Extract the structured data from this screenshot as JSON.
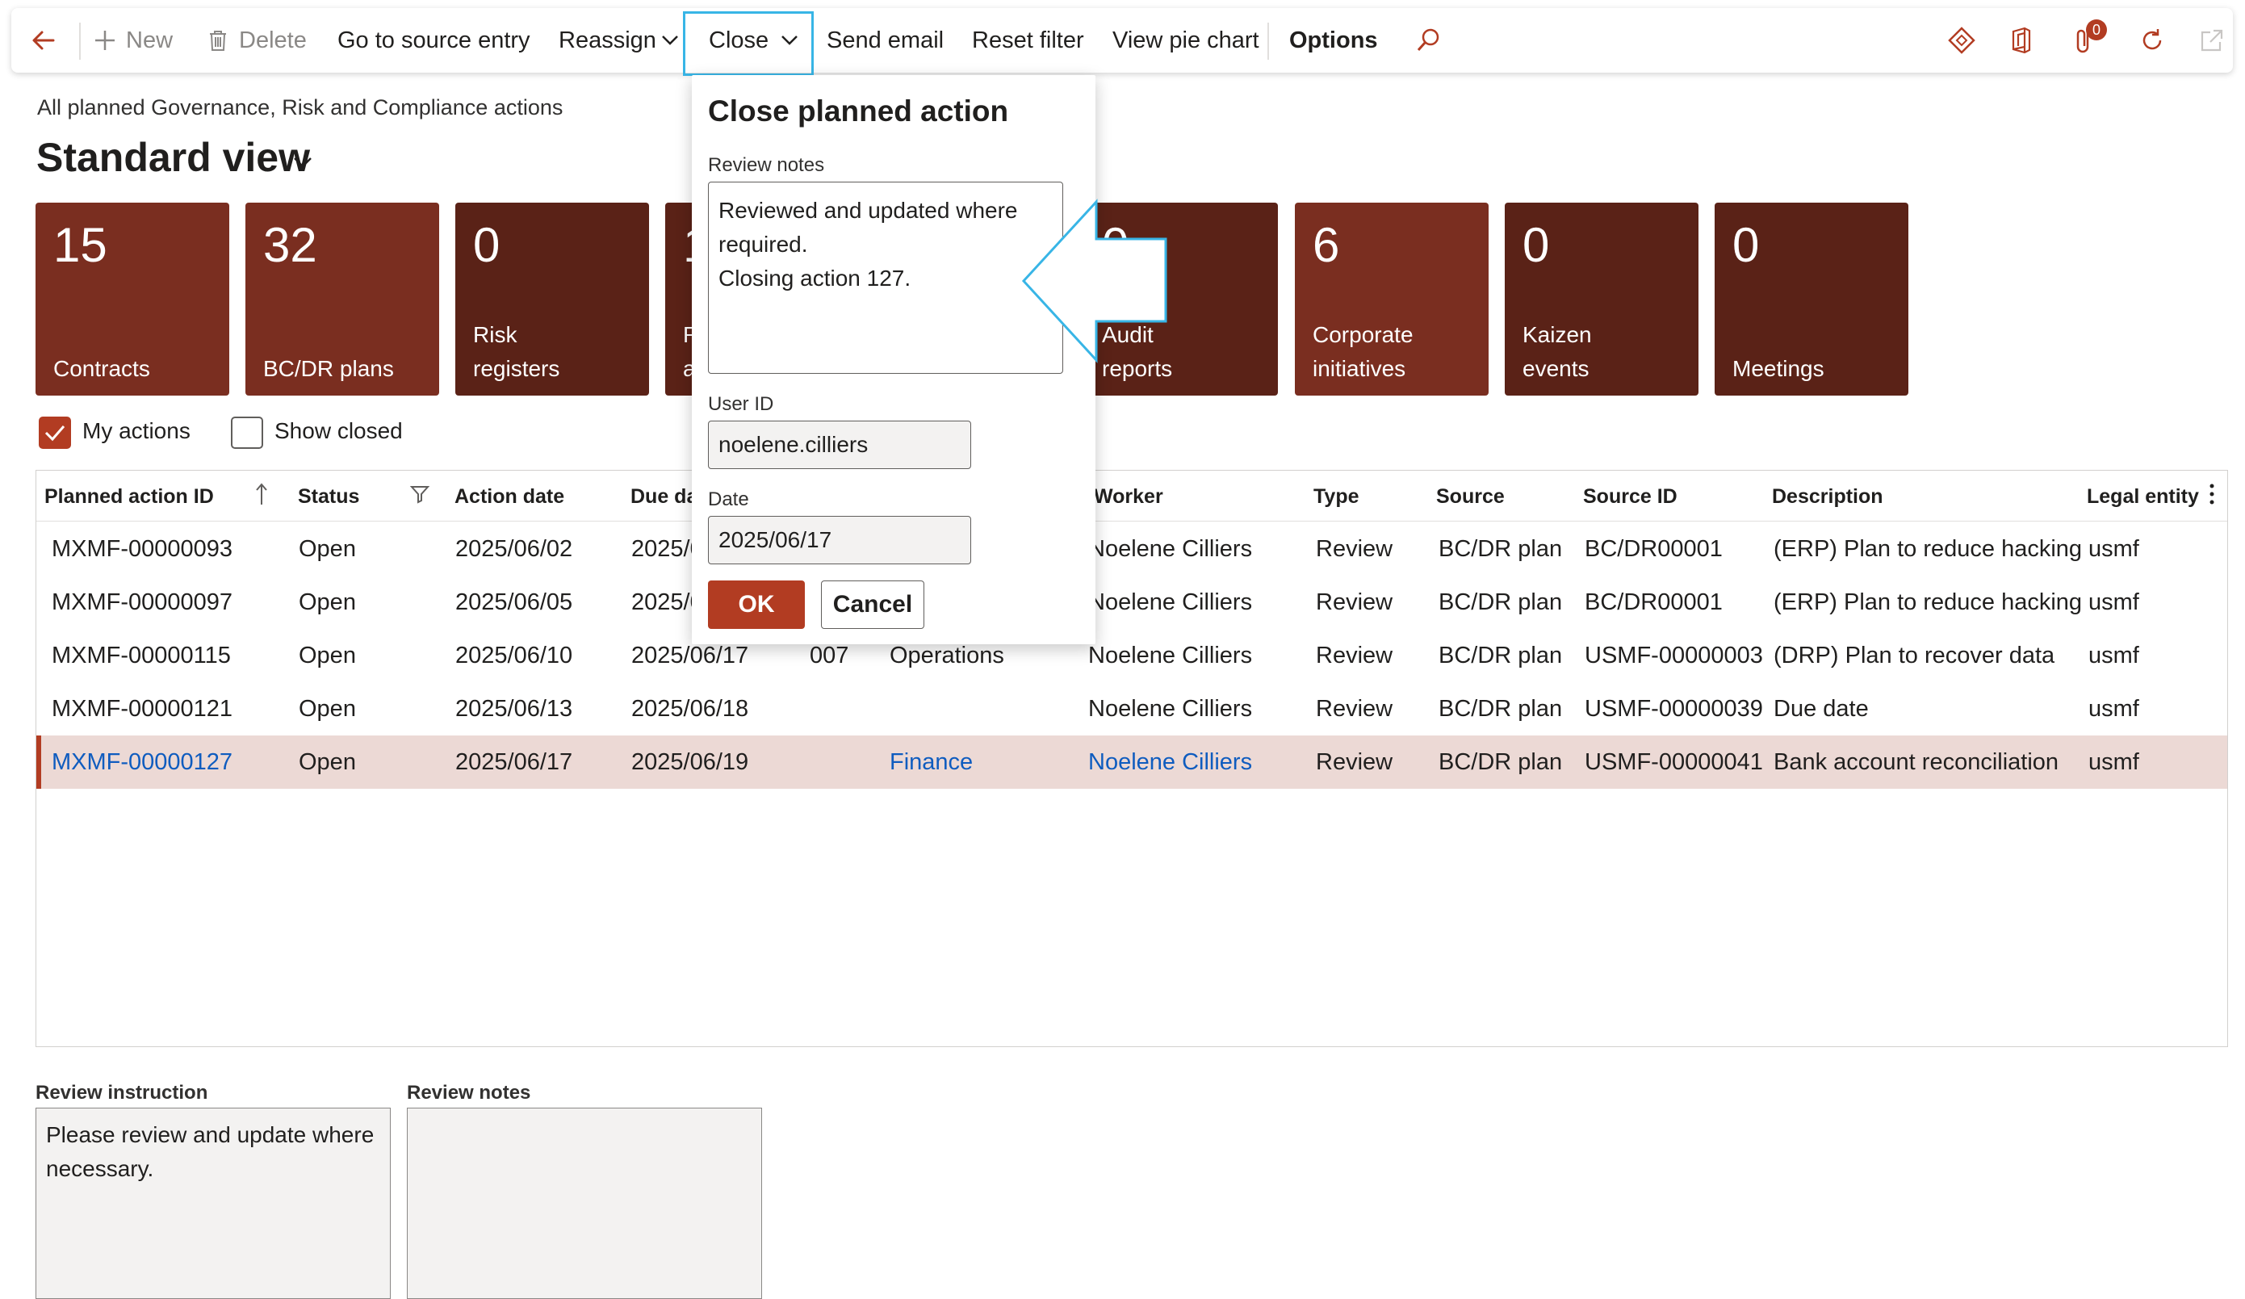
{
  "actionpane": {
    "new_label": "New",
    "delete_label": "Delete",
    "go_to_source_label": "Go to source entry",
    "reassign_label": "Reassign",
    "close_label": "Close",
    "send_email_label": "Send email",
    "reset_filter_label": "Reset filter",
    "view_pie_chart_label": "View pie chart",
    "options_label": "Options",
    "notification_count": "0"
  },
  "page": {
    "breadcrumb": "All planned Governance, Risk and Compliance actions",
    "view_title": "Standard view"
  },
  "tiles": [
    {
      "count": "15",
      "label": "Contracts"
    },
    {
      "count": "32",
      "label": "BC/DR plans"
    },
    {
      "count": "0",
      "label": "Risk registers"
    },
    {
      "count": "1",
      "label": "R a"
    },
    {
      "count": "0",
      "label": "Audit reports"
    },
    {
      "count": "6",
      "label": "Corporate initiatives"
    },
    {
      "count": "0",
      "label": "Kaizen events"
    },
    {
      "count": "0",
      "label": "Meetings"
    }
  ],
  "filters": {
    "my_actions_label": "My actions",
    "my_actions_checked": true,
    "show_closed_label": "Show closed",
    "show_closed_checked": false
  },
  "grid": {
    "headers": {
      "planned_action_id": "Planned action ID",
      "status": "Status",
      "action_date": "Action date",
      "due_date": "Due da",
      "worker": "Worker",
      "type": "Type",
      "source": "Source",
      "source_id": "Source ID",
      "description": "Description",
      "legal_entity": "Legal entity"
    },
    "rows": [
      {
        "id": "MXMF-00000093",
        "status": "Open",
        "action_date": "2025/06/02",
        "due_date": "2025/0",
        "code": "",
        "department": "",
        "worker": "Noelene Cilliers",
        "type": "Review",
        "source": "BC/DR plan",
        "source_id": "BC/DR00001",
        "description": "(ERP) Plan to reduce hacking",
        "legal_entity": "usmf"
      },
      {
        "id": "MXMF-00000097",
        "status": "Open",
        "action_date": "2025/06/05",
        "due_date": "2025/0",
        "code": "",
        "department": "",
        "worker": "Noelene Cilliers",
        "type": "Review",
        "source": "BC/DR plan",
        "source_id": "BC/DR00001",
        "description": "(ERP) Plan to reduce hacking",
        "legal_entity": "usmf"
      },
      {
        "id": "MXMF-00000115",
        "status": "Open",
        "action_date": "2025/06/10",
        "due_date": "2025/06/17",
        "code": "007",
        "department": "Operations",
        "worker": "Noelene Cilliers",
        "type": "Review",
        "source": "BC/DR plan",
        "source_id": "USMF-00000003",
        "description": "(DRP) Plan to recover data",
        "legal_entity": "usmf"
      },
      {
        "id": "MXMF-00000121",
        "status": "Open",
        "action_date": "2025/06/13",
        "due_date": "2025/06/18",
        "code": "",
        "department": "",
        "worker": "Noelene Cilliers",
        "type": "Review",
        "source": "BC/DR plan",
        "source_id": "USMF-00000039",
        "description": "Due date",
        "legal_entity": "usmf"
      },
      {
        "id": "MXMF-00000127",
        "status": "Open",
        "action_date": "2025/06/17",
        "due_date": "2025/06/19",
        "code": "",
        "department": "Finance",
        "worker": "Noelene Cilliers",
        "type": "Review",
        "source": "BC/DR plan",
        "source_id": "USMF-00000041",
        "description": "Bank account reconciliation",
        "legal_entity": "usmf"
      }
    ]
  },
  "details": {
    "review_instruction_label": "Review instruction",
    "review_instruction_value": "Please review and update where necessary.",
    "review_notes_label": "Review notes",
    "review_notes_value": ""
  },
  "dialog": {
    "title": "Close planned action",
    "review_notes_label": "Review notes",
    "review_notes_value": "Reviewed and updated where required.\nClosing action 127.",
    "user_id_label": "User ID",
    "user_id_value": "noelene.cilliers",
    "date_label": "Date",
    "date_value": "2025/06/17",
    "ok_label": "OK",
    "cancel_label": "Cancel"
  },
  "colors": {
    "accent": "#b23c22",
    "tile_light": "#7a2e20",
    "tile_dark": "#5a2217",
    "selected_row": "#ecd9d5",
    "link": "#0f5cbf",
    "callout": "#38b5e6"
  }
}
